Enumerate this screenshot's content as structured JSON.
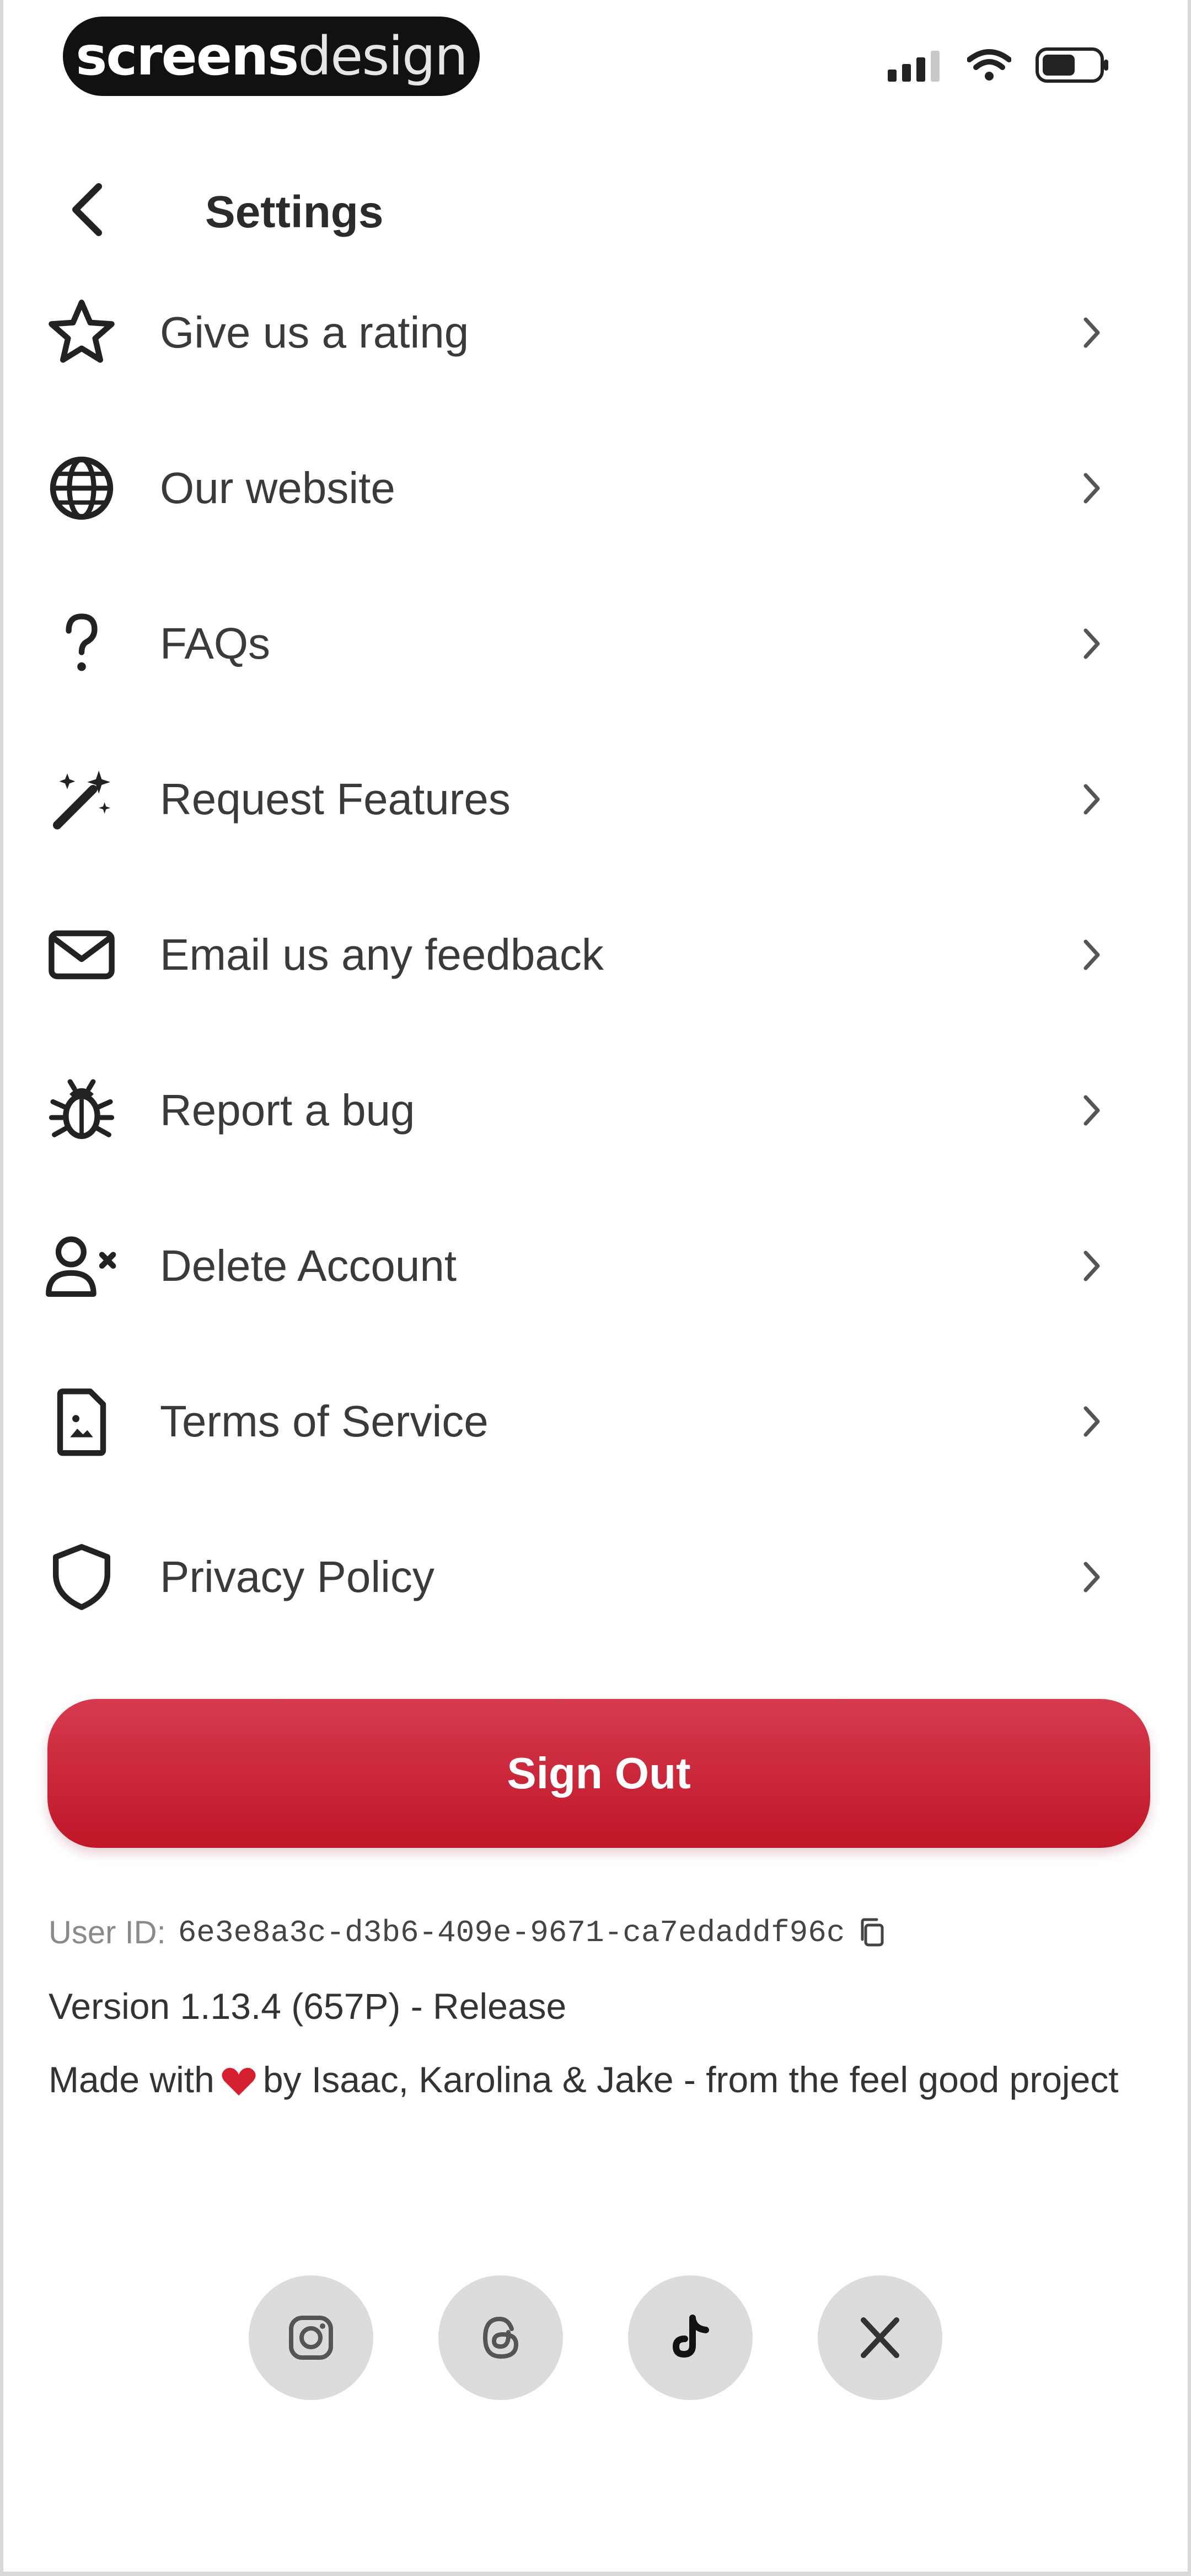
{
  "status_bar": {
    "brand_bold": "screens",
    "brand_light": "design"
  },
  "header": {
    "title": "Settings",
    "back_icon": "chevron-left-icon"
  },
  "menu": {
    "items": [
      {
        "label": "Give us a rating",
        "icon": "star-icon"
      },
      {
        "label": "Our website",
        "icon": "globe-icon"
      },
      {
        "label": "FAQs",
        "icon": "question-icon"
      },
      {
        "label": "Request Features",
        "icon": "magic-wand-icon"
      },
      {
        "label": "Email us any feedback",
        "icon": "mail-icon"
      },
      {
        "label": "Report a bug",
        "icon": "bug-icon"
      },
      {
        "label": "Delete Account",
        "icon": "user-remove-icon"
      },
      {
        "label": "Terms of Service",
        "icon": "document-icon"
      },
      {
        "label": "Privacy Policy",
        "icon": "shield-icon"
      }
    ]
  },
  "sign_out": {
    "label": "Sign Out",
    "color": "#c8192d"
  },
  "footer": {
    "user_id_label": "User ID:",
    "user_id_value": "6e3e8a3c-d3b6-409e-9671-ca7edaddf96c",
    "version": "Version 1.13.4 (657P) - Release",
    "made_with_prefix": "Made with",
    "made_with_suffix": "by Isaac, Karolina & Jake - from the feel good project"
  },
  "social": [
    {
      "icon": "instagram-icon"
    },
    {
      "icon": "threads-icon"
    },
    {
      "icon": "tiktok-icon"
    },
    {
      "icon": "x-icon"
    }
  ]
}
